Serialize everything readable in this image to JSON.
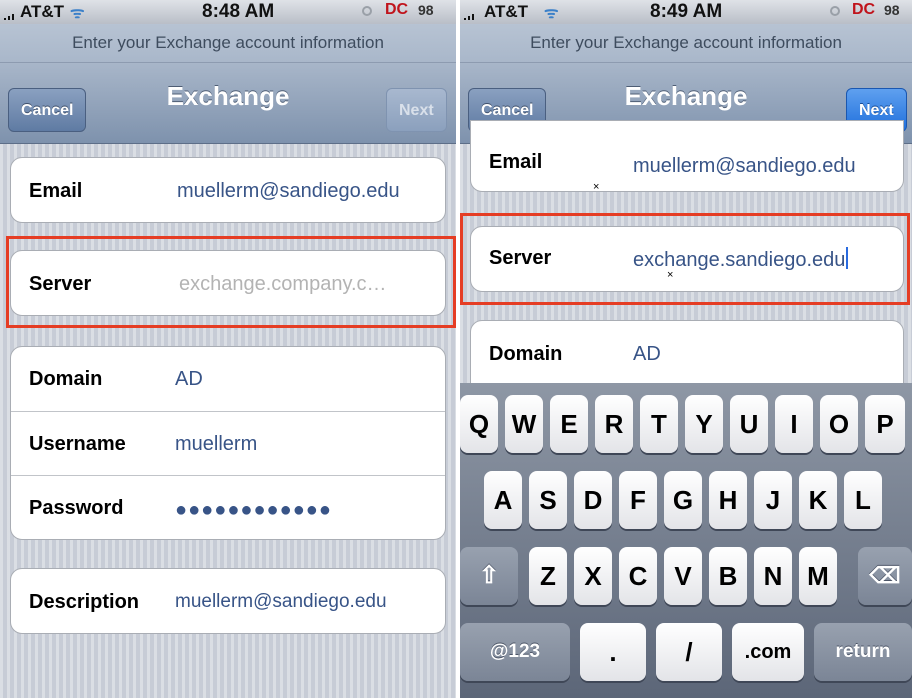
{
  "left": {
    "status": {
      "carrier": "AT&T",
      "time": "8:48 AM",
      "battery": "98"
    },
    "prompt": "Enter your Exchange account information",
    "nav": {
      "cancel": "Cancel",
      "title": "Exchange",
      "next": "Next"
    },
    "fields": {
      "email": {
        "label": "Email",
        "value": "muellerm@sandiego.edu"
      },
      "server": {
        "label": "Server",
        "placeholder": "exchange.company.c…"
      },
      "domain": {
        "label": "Domain",
        "value": "AD"
      },
      "username": {
        "label": "Username",
        "value": "muellerm"
      },
      "password": {
        "label": "Password",
        "value": "●●●●●●●●●●●●"
      },
      "description": {
        "label": "Description",
        "value": "muellerm@sandiego.edu"
      }
    }
  },
  "right": {
    "status": {
      "carrier": "AT&T",
      "time": "8:49 AM",
      "battery": "98"
    },
    "prompt": "Enter your Exchange account information",
    "nav": {
      "cancel": "Cancel",
      "title": "Exchange",
      "next": "Next"
    },
    "fields": {
      "email": {
        "label": "Email",
        "value": "muellerm@sandiego.edu"
      },
      "server": {
        "label": "Server",
        "value": "exchange.sandiego.edu"
      },
      "domain": {
        "label": "Domain",
        "value": "AD"
      }
    },
    "keyboard": {
      "row1": [
        "Q",
        "W",
        "E",
        "R",
        "T",
        "Y",
        "U",
        "I",
        "O",
        "P"
      ],
      "row2": [
        "A",
        "S",
        "D",
        "F",
        "G",
        "H",
        "J",
        "K",
        "L"
      ],
      "row3": [
        "Z",
        "X",
        "C",
        "V",
        "B",
        "N",
        "M"
      ],
      "bottom": {
        "numbers": "@123",
        "dot": ".",
        "slash": "/",
        "com": ".com",
        "return": "return"
      },
      "shift_icon": "shift-icon",
      "delete_icon": "delete-icon"
    }
  },
  "colors": {
    "highlight": "#e53d24",
    "value_text": "#385487",
    "next_active": "#2a78e4"
  }
}
